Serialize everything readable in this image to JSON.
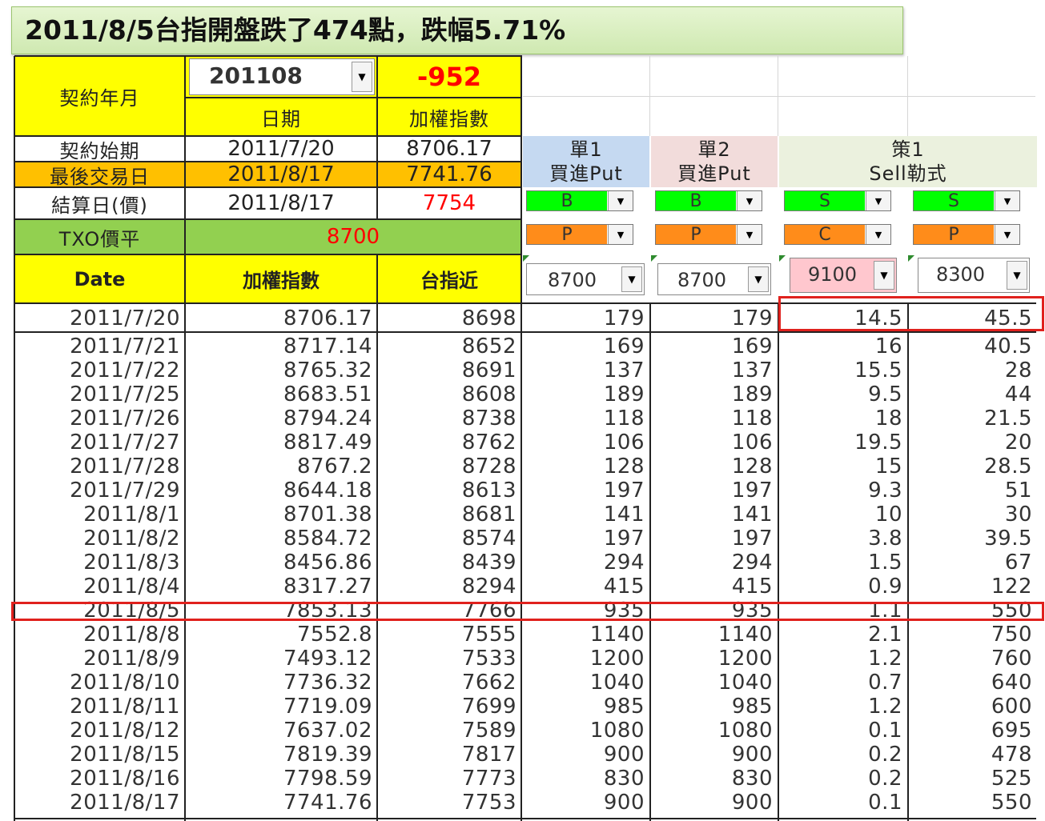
{
  "banner": "2011/8/5台指開盤跌了474點，跌幅5.71%",
  "contract": {
    "label": "契約年月",
    "month_value": "201108",
    "diff": "-952",
    "date_header": "日期",
    "index_header": "加權指數"
  },
  "info_rows": [
    {
      "label": "契約始期",
      "date": "2011/7/20",
      "value": "8706.17"
    },
    {
      "label": "最後交易日",
      "date": "2011/8/17",
      "value": "7741.76"
    },
    {
      "label": "結算日(價)",
      "date": "2011/8/17",
      "value": "7754"
    }
  ],
  "txo": {
    "label": "TXO價平",
    "value": "8700"
  },
  "columns": {
    "date": "Date",
    "index": "加權指數",
    "near": "台指近"
  },
  "strategies": [
    {
      "line1": "單1",
      "line2": "買進Put",
      "side": "B",
      "type": "P",
      "strike": "8700"
    },
    {
      "line1": "單2",
      "line2": "買進Put",
      "side": "B",
      "type": "P",
      "strike": "8700"
    },
    {
      "line1": "策1",
      "line2": "Sell勒式",
      "side": "S",
      "type": "C",
      "strike": "9100"
    },
    {
      "line1": "",
      "line2": "",
      "side": "S",
      "type": "P",
      "strike": "8300"
    }
  ],
  "rows": [
    {
      "date": "2011/7/20",
      "index": "8706.17",
      "near": "8698",
      "s1": "179",
      "s2": "179",
      "s3": "14.5",
      "s4": "45.5"
    },
    {
      "date": "2011/7/21",
      "index": "8717.14",
      "near": "8652",
      "s1": "169",
      "s2": "169",
      "s3": "16",
      "s4": "40.5"
    },
    {
      "date": "2011/7/22",
      "index": "8765.32",
      "near": "8691",
      "s1": "137",
      "s2": "137",
      "s3": "15.5",
      "s4": "28"
    },
    {
      "date": "2011/7/25",
      "index": "8683.51",
      "near": "8608",
      "s1": "189",
      "s2": "189",
      "s3": "9.5",
      "s4": "44"
    },
    {
      "date": "2011/7/26",
      "index": "8794.24",
      "near": "8738",
      "s1": "118",
      "s2": "118",
      "s3": "18",
      "s4": "21.5"
    },
    {
      "date": "2011/7/27",
      "index": "8817.49",
      "near": "8762",
      "s1": "106",
      "s2": "106",
      "s3": "19.5",
      "s4": "20"
    },
    {
      "date": "2011/7/28",
      "index": "8767.2",
      "near": "8728",
      "s1": "128",
      "s2": "128",
      "s3": "15",
      "s4": "28.5"
    },
    {
      "date": "2011/7/29",
      "index": "8644.18",
      "near": "8613",
      "s1": "197",
      "s2": "197",
      "s3": "9.3",
      "s4": "51"
    },
    {
      "date": "2011/8/1",
      "index": "8701.38",
      "near": "8681",
      "s1": "141",
      "s2": "141",
      "s3": "10",
      "s4": "30"
    },
    {
      "date": "2011/8/2",
      "index": "8584.72",
      "near": "8574",
      "s1": "197",
      "s2": "197",
      "s3": "3.8",
      "s4": "39.5"
    },
    {
      "date": "2011/8/3",
      "index": "8456.86",
      "near": "8439",
      "s1": "294",
      "s2": "294",
      "s3": "1.5",
      "s4": "67"
    },
    {
      "date": "2011/8/4",
      "index": "8317.27",
      "near": "8294",
      "s1": "415",
      "s2": "415",
      "s3": "0.9",
      "s4": "122"
    },
    {
      "date": "2011/8/5",
      "index": "7853.13",
      "near": "7766",
      "s1": "935",
      "s2": "935",
      "s3": "1.1",
      "s4": "550"
    },
    {
      "date": "2011/8/8",
      "index": "7552.8",
      "near": "7555",
      "s1": "1140",
      "s2": "1140",
      "s3": "2.1",
      "s4": "750"
    },
    {
      "date": "2011/8/9",
      "index": "7493.12",
      "near": "7533",
      "s1": "1200",
      "s2": "1200",
      "s3": "1.2",
      "s4": "760"
    },
    {
      "date": "2011/8/10",
      "index": "7736.32",
      "near": "7662",
      "s1": "1040",
      "s2": "1040",
      "s3": "0.7",
      "s4": "640"
    },
    {
      "date": "2011/8/11",
      "index": "7719.09",
      "near": "7699",
      "s1": "985",
      "s2": "985",
      "s3": "1.2",
      "s4": "600"
    },
    {
      "date": "2011/8/12",
      "index": "7637.02",
      "near": "7589",
      "s1": "1080",
      "s2": "1080",
      "s3": "0.1",
      "s4": "695"
    },
    {
      "date": "2011/8/15",
      "index": "7819.39",
      "near": "7817",
      "s1": "900",
      "s2": "900",
      "s3": "0.2",
      "s4": "478"
    },
    {
      "date": "2011/8/16",
      "index": "7798.59",
      "near": "7773",
      "s1": "830",
      "s2": "830",
      "s3": "0.2",
      "s4": "525"
    },
    {
      "date": "2011/8/17",
      "index": "7741.76",
      "near": "7753",
      "s1": "900",
      "s2": "900",
      "s3": "0.1",
      "s4": "550"
    }
  ],
  "colors": {
    "highlight": "#e0211d",
    "header_yellow": "#ffff00",
    "last_trade_orange": "#ffc000",
    "txo_green": "#92d050",
    "negative_red": "#ff0000"
  }
}
